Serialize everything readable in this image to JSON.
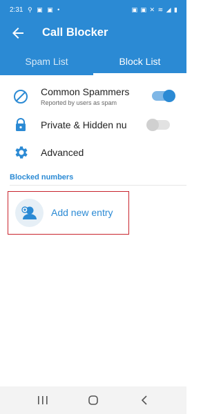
{
  "status": {
    "time": "2:31",
    "left_icons": "⚲ ▣ ▣ •",
    "right_icons": "▣ ▣ ✕ ≋ ◢ ▮"
  },
  "appbar": {
    "title": "Call Blocker",
    "back_icon": "arrow-left-icon"
  },
  "tabs": [
    {
      "label": "Spam List",
      "selected": false
    },
    {
      "label": "Block List",
      "selected": true
    }
  ],
  "settings": [
    {
      "icon": "block-icon",
      "title": "Common Spammers",
      "subtitle": "Reported by users as spam",
      "toggle": true
    },
    {
      "icon": "lock-icon",
      "title": "Private & Hidden nu",
      "toggle": false
    },
    {
      "icon": "gear-icon",
      "title": "Advanced"
    }
  ],
  "section": {
    "label": "Blocked numbers"
  },
  "entry": {
    "label": "Add new entry",
    "icon": "add-contact-icon"
  },
  "navbar": {
    "icons": [
      "recents-icon",
      "home-icon",
      "back-icon"
    ]
  },
  "colors": {
    "primary": "#2b8ad4",
    "highlight": "#c8232c",
    "switch_off": "#d9d9d9"
  }
}
